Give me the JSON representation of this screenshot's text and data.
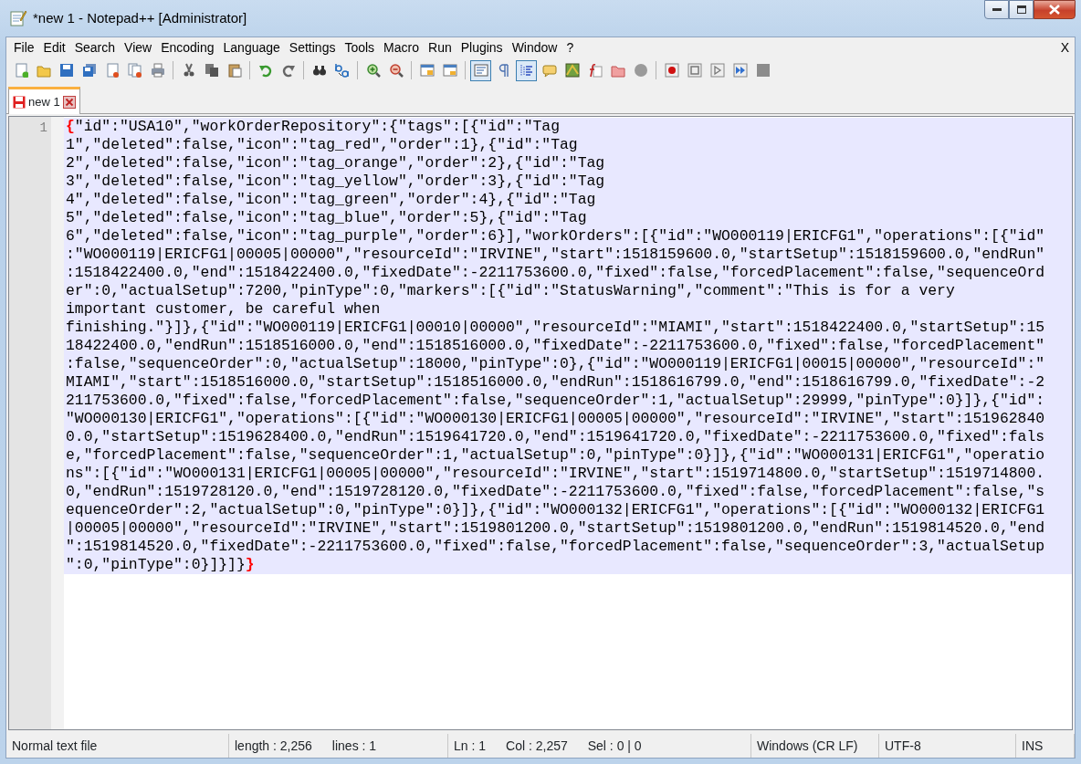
{
  "window": {
    "title": "*new 1 - Notepad++ [Administrator]"
  },
  "menu": [
    "File",
    "Edit",
    "Search",
    "View",
    "Encoding",
    "Language",
    "Settings",
    "Tools",
    "Macro",
    "Run",
    "Plugins",
    "Window",
    "?"
  ],
  "menu_close": "X",
  "toolbar": [
    {
      "kind": "new"
    },
    {
      "kind": "open"
    },
    {
      "kind": "save"
    },
    {
      "kind": "saveall"
    },
    {
      "kind": "close"
    },
    {
      "kind": "closeall"
    },
    {
      "kind": "print"
    },
    {
      "kind": "sep"
    },
    {
      "kind": "cut"
    },
    {
      "kind": "copy"
    },
    {
      "kind": "paste"
    },
    {
      "kind": "sep"
    },
    {
      "kind": "undo"
    },
    {
      "kind": "redo"
    },
    {
      "kind": "sep"
    },
    {
      "kind": "find"
    },
    {
      "kind": "replace"
    },
    {
      "kind": "sep"
    },
    {
      "kind": "zoomin"
    },
    {
      "kind": "zoomout"
    },
    {
      "kind": "sep"
    },
    {
      "kind": "syncv"
    },
    {
      "kind": "synch"
    },
    {
      "kind": "sep"
    },
    {
      "kind": "wrap",
      "pressed": true
    },
    {
      "kind": "pilcrow",
      "pressed": false
    },
    {
      "kind": "indent",
      "pressed": true
    },
    {
      "kind": "udl"
    },
    {
      "kind": "docmap"
    },
    {
      "kind": "funclist"
    },
    {
      "kind": "folder"
    },
    {
      "kind": "monitor"
    },
    {
      "kind": "sep"
    },
    {
      "kind": "record"
    },
    {
      "kind": "stop"
    },
    {
      "kind": "play"
    },
    {
      "kind": "playmulti"
    },
    {
      "kind": "savemacro"
    }
  ],
  "tabs": [
    {
      "label": "new 1",
      "selected": true,
      "modified": true
    }
  ],
  "editor": {
    "brace_match": true,
    "lines": [
      {
        "number": "1",
        "current": true,
        "wraps": [
          "{\"id\":\"USA10\",\"workOrderRepository\":{\"tags\":[{\"id\":\"Tag",
          "1\",\"deleted\":false,\"icon\":\"tag_red\",\"order\":1},{\"id\":\"Tag",
          "2\",\"deleted\":false,\"icon\":\"tag_orange\",\"order\":2},{\"id\":\"Tag",
          "3\",\"deleted\":false,\"icon\":\"tag_yellow\",\"order\":3},{\"id\":\"Tag",
          "4\",\"deleted\":false,\"icon\":\"tag_green\",\"order\":4},{\"id\":\"Tag",
          "5\",\"deleted\":false,\"icon\":\"tag_blue\",\"order\":5},{\"id\":\"Tag",
          "6\",\"deleted\":false,\"icon\":\"tag_purple\",\"order\":6}],\"workOrders\":[{\"id\":\"WO000119|ERICFG1\",\"operations\":[{\"id\"",
          ":\"WO000119|ERICFG1|00005|00000\",\"resourceId\":\"IRVINE\",\"start\":1518159600.0,\"startSetup\":1518159600.0,\"endRun\"",
          ":1518422400.0,\"end\":1518422400.0,\"fixedDate\":-2211753600.0,\"fixed\":false,\"forcedPlacement\":false,\"sequenceOrd",
          "er\":0,\"actualSetup\":7200,\"pinType\":0,\"markers\":[{\"id\":\"StatusWarning\",\"comment\":\"This is for a very",
          "important customer, be careful when",
          "finishing.\"}]},{\"id\":\"WO000119|ERICFG1|00010|00000\",\"resourceId\":\"MIAMI\",\"start\":1518422400.0,\"startSetup\":15",
          "18422400.0,\"endRun\":1518516000.0,\"end\":1518516000.0,\"fixedDate\":-2211753600.0,\"fixed\":false,\"forcedPlacement\"",
          ":false,\"sequenceOrder\":0,\"actualSetup\":18000,\"pinType\":0},{\"id\":\"WO000119|ERICFG1|00015|00000\",\"resourceId\":\"",
          "MIAMI\",\"start\":1518516000.0,\"startSetup\":1518516000.0,\"endRun\":1518616799.0,\"end\":1518616799.0,\"fixedDate\":-2",
          "211753600.0,\"fixed\":false,\"forcedPlacement\":false,\"sequenceOrder\":1,\"actualSetup\":29999,\"pinType\":0}]},{\"id\":",
          "\"WO000130|ERICFG1\",\"operations\":[{\"id\":\"WO000130|ERICFG1|00005|00000\",\"resourceId\":\"IRVINE\",\"start\":151962840",
          "0.0,\"startSetup\":1519628400.0,\"endRun\":1519641720.0,\"end\":1519641720.0,\"fixedDate\":-2211753600.0,\"fixed\":fals",
          "e,\"forcedPlacement\":false,\"sequenceOrder\":1,\"actualSetup\":0,\"pinType\":0}]},{\"id\":\"WO000131|ERICFG1\",\"operatio",
          "ns\":[{\"id\":\"WO000131|ERICFG1|00005|00000\",\"resourceId\":\"IRVINE\",\"start\":1519714800.0,\"startSetup\":1519714800.",
          "0,\"endRun\":1519728120.0,\"end\":1519728120.0,\"fixedDate\":-2211753600.0,\"fixed\":false,\"forcedPlacement\":false,\"s",
          "equenceOrder\":2,\"actualSetup\":0,\"pinType\":0}]},{\"id\":\"WO000132|ERICFG1\",\"operations\":[{\"id\":\"WO000132|ERICFG1",
          "|00005|00000\",\"resourceId\":\"IRVINE\",\"start\":1519801200.0,\"startSetup\":1519801200.0,\"endRun\":1519814520.0,\"end",
          "\":1519814520.0,\"fixedDate\":-2211753600.0,\"fixed\":false,\"forcedPlacement\":false,\"sequenceOrder\":3,\"actualSetup",
          "\":0,\"pinType\":0}]}]}}"
        ]
      }
    ]
  },
  "status_bar": [
    [
      "Normal text file"
    ],
    [
      "length : 2,256",
      "lines : 1"
    ],
    [
      "Ln : 1",
      "Col : 2,257",
      "Sel : 0 | 0"
    ],
    [
      "Windows (CR LF)"
    ],
    [
      "UTF-8"
    ],
    [
      "INS"
    ]
  ]
}
